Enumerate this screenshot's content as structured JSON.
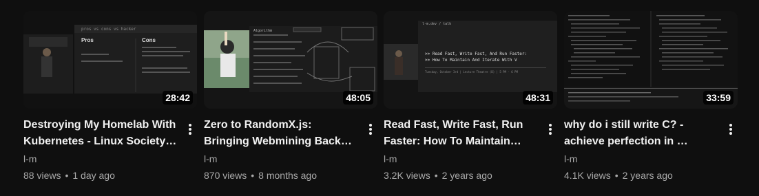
{
  "videos": [
    {
      "title": "Destroying My Homelab With Kubernetes - Linux Society …",
      "channel": "l-m",
      "views": "88 views",
      "age": "1 day ago",
      "duration": "28:42",
      "thumb": {
        "header": "pros vs cons vs hacker",
        "pros_label": "Pros",
        "cons_label": "Cons"
      }
    },
    {
      "title": "Zero to RandomX.js: Bringing Webmining Back From The …",
      "channel": "l-m",
      "views": "870 views",
      "age": "8 months ago",
      "duration": "48:05",
      "thumb": {
        "header": "Algorithm"
      }
    },
    {
      "title": "Read Fast, Write Fast, Run Faster: How To Maintain An…",
      "channel": "l-m",
      "views": "3.2K views",
      "age": "2 years ago",
      "duration": "48:31",
      "thumb": {
        "site": "l-m.dev / talk",
        "line1": ">> Read Fast, Write Fast, And Run Faster:",
        "line2": ">> How To Maintain And Iterate With V",
        "footer": "Tuesday, October 3rd | Lecture Theatre (D) | 5 PM - 6 PM"
      }
    },
    {
      "title": "why do i still write C? - achieve perfection in …",
      "channel": "l-m",
      "views": "4.1K views",
      "age": "2 years ago",
      "duration": "33:59",
      "thumb": {}
    }
  ],
  "colors": {
    "background": "#0f0f0f",
    "title": "#f1f1f1",
    "secondary": "#aaaaaa",
    "accent_red": "#ff4d4d"
  },
  "icons": {
    "more": "more-vert-icon"
  }
}
